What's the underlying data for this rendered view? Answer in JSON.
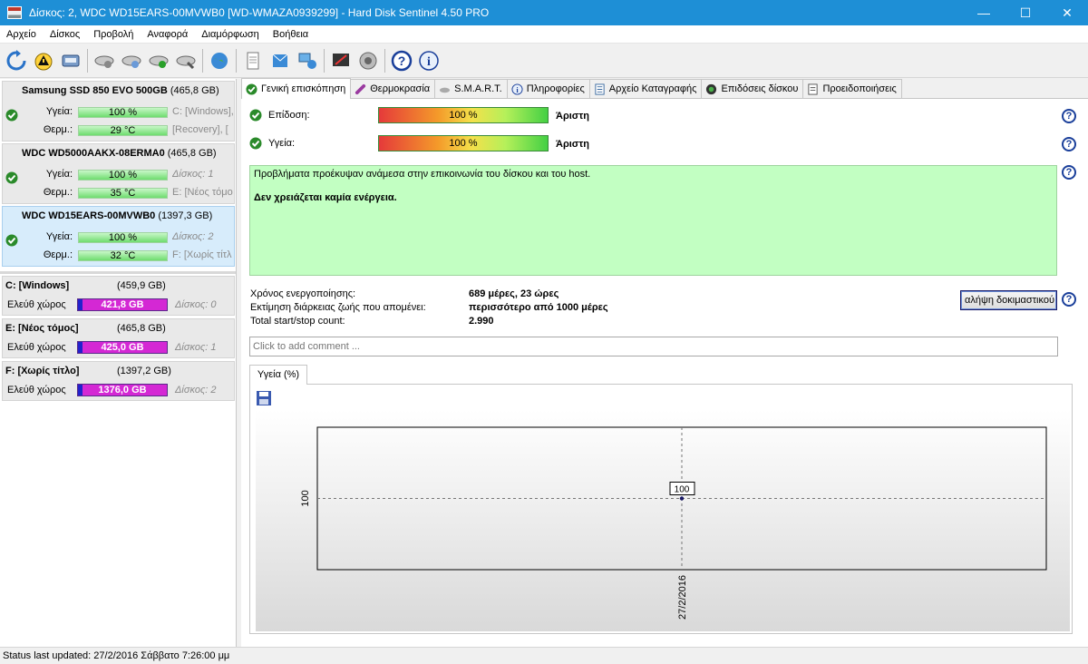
{
  "window": {
    "title": "Δίσκος: 2, WDC WD15EARS-00MVWB0 [WD-WMAZA0939299] - Hard Disk Sentinel 4.50 PRO",
    "minimize": "—",
    "maximize": "☐",
    "close": "✕"
  },
  "menu": [
    "Αρχείο",
    "Δίσκος",
    "Προβολή",
    "Αναφορά",
    "Διαμόρφωση",
    "Βοήθεια"
  ],
  "disks": [
    {
      "name": "Samsung SSD 850 EVO 500GB",
      "size": "(465,8 GB)",
      "health_label": "Υγεία:",
      "health": "100 %",
      "temp_label": "Θερμ.:",
      "temp": "29 °C",
      "side1": "C: [Windows],",
      "side2": "[Recovery], [",
      "health_pct": 100
    },
    {
      "name": "WDC WD5000AAKX-08ERMA0",
      "size": "(465,8 GB)",
      "health_label": "Υγεία:",
      "health": "100 %",
      "temp_label": "Θερμ.:",
      "temp": "35 °C",
      "side1": "Δίσκος: 1",
      "side2": "E: [Νέος τόμο",
      "health_pct": 100
    },
    {
      "name": "WDC WD15EARS-00MVWB0",
      "size": "(1397,3 GB)",
      "health_label": "Υγεία:",
      "health": "100 %",
      "temp_label": "Θερμ.:",
      "temp": "32 °C",
      "side1": "Δίσκος: 2",
      "side2": "F: [Χωρίς τίτλ",
      "health_pct": 100
    }
  ],
  "partitions": [
    {
      "name": "C: [Windows]",
      "size": "(459,9 GB)",
      "free_label": "Ελεύθ χώρος",
      "free": "421,8 GB",
      "disk": "Δίσκος: 0"
    },
    {
      "name": "E: [Νέος τόμος]",
      "size": "(465,8 GB)",
      "free_label": "Ελεύθ χώρος",
      "free": "425,0 GB",
      "disk": "Δίσκος: 1"
    },
    {
      "name": "F: [Χωρίς τίτλο]",
      "size": "(1397,2 GB)",
      "free_label": "Ελεύθ χώρος",
      "free": "1376,0 GB",
      "disk": "Δίσκος: 2"
    }
  ],
  "tabs": [
    "Γενική επισκόπηση",
    "Θερμοκρασία",
    "S.M.A.R.T.",
    "Πληροφορίες",
    "Αρχείο Καταγραφής",
    "Επιδόσεις δίσκου",
    "Προειδοποιήσεις"
  ],
  "overview": {
    "performance_label": "Επίδοση:",
    "performance_value": "100 %",
    "performance_pct": 100,
    "performance_rating": "Άριστη",
    "health_label": "Υγεία:",
    "health_value": "100 %",
    "health_pct": 100,
    "health_rating": "Άριστη",
    "info_line1": "Προβλήματα προέκυψαν ανάμεσα στην επικοινωνία του δίσκου και του host.",
    "info_line2": "Δεν χρειάζεται καμία ενέργεια.",
    "power_on_label": "Χρόνος ενεργοποίησης:",
    "power_on_value": "689 μέρες, 23 ώρες",
    "lifetime_label": "Εκτίμηση διάρκειας ζωής που απομένει:",
    "lifetime_value": "περισσότερο από 1000 μέρες",
    "startstop_label": "Total start/stop count:",
    "startstop_value": "2.990",
    "test_button": "αλήψη δοκιμαστικού",
    "comment_placeholder": "Click to add comment ...",
    "help": "?"
  },
  "chart_tab": "Υγεία (%)",
  "chart_data": {
    "type": "line",
    "title": "",
    "x": [
      "27/2/2016"
    ],
    "series": [
      {
        "values": [
          100
        ]
      }
    ],
    "data_labels": [
      "100"
    ],
    "ytick_labels": [
      "100"
    ],
    "xlabel": "",
    "ylabel": "",
    "grid": true
  },
  "status": "Status last updated: 27/2/2016 Σάββατο 7:26:00 μμ",
  "colors": {
    "titlebar": "#1e8fd6",
    "info_bg": "#c2ffc2",
    "free_bar": "#d428d4",
    "health_bar": "#6fdc6f"
  }
}
